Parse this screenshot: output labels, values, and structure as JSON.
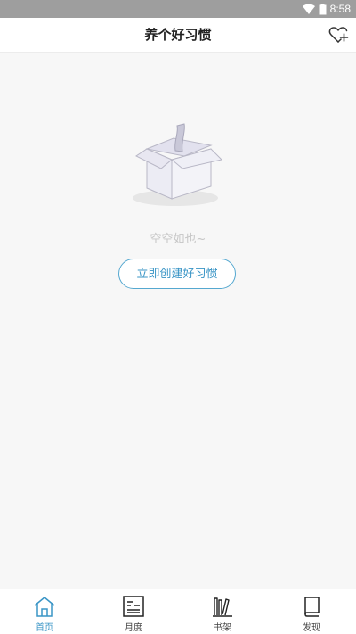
{
  "status_bar": {
    "time": "8:58"
  },
  "header": {
    "title": "养个好习惯",
    "favorite_icon": "heart-plus-icon"
  },
  "empty_state": {
    "message": "空空如也~",
    "button_label": "立即创建好习惯",
    "illustration": "empty-box-illustration"
  },
  "tabbar": {
    "tabs": [
      {
        "label": "首页",
        "icon": "home-icon",
        "active": true
      },
      {
        "label": "月度",
        "icon": "monthly-icon",
        "active": false
      },
      {
        "label": "书架",
        "icon": "bookshelf-icon",
        "active": false
      },
      {
        "label": "发现",
        "icon": "discover-book-icon",
        "active": false
      }
    ]
  },
  "colors": {
    "accent": "#3a95c6",
    "status_bar": "#9e9e9e",
    "empty_text": "#c6c6c6"
  }
}
